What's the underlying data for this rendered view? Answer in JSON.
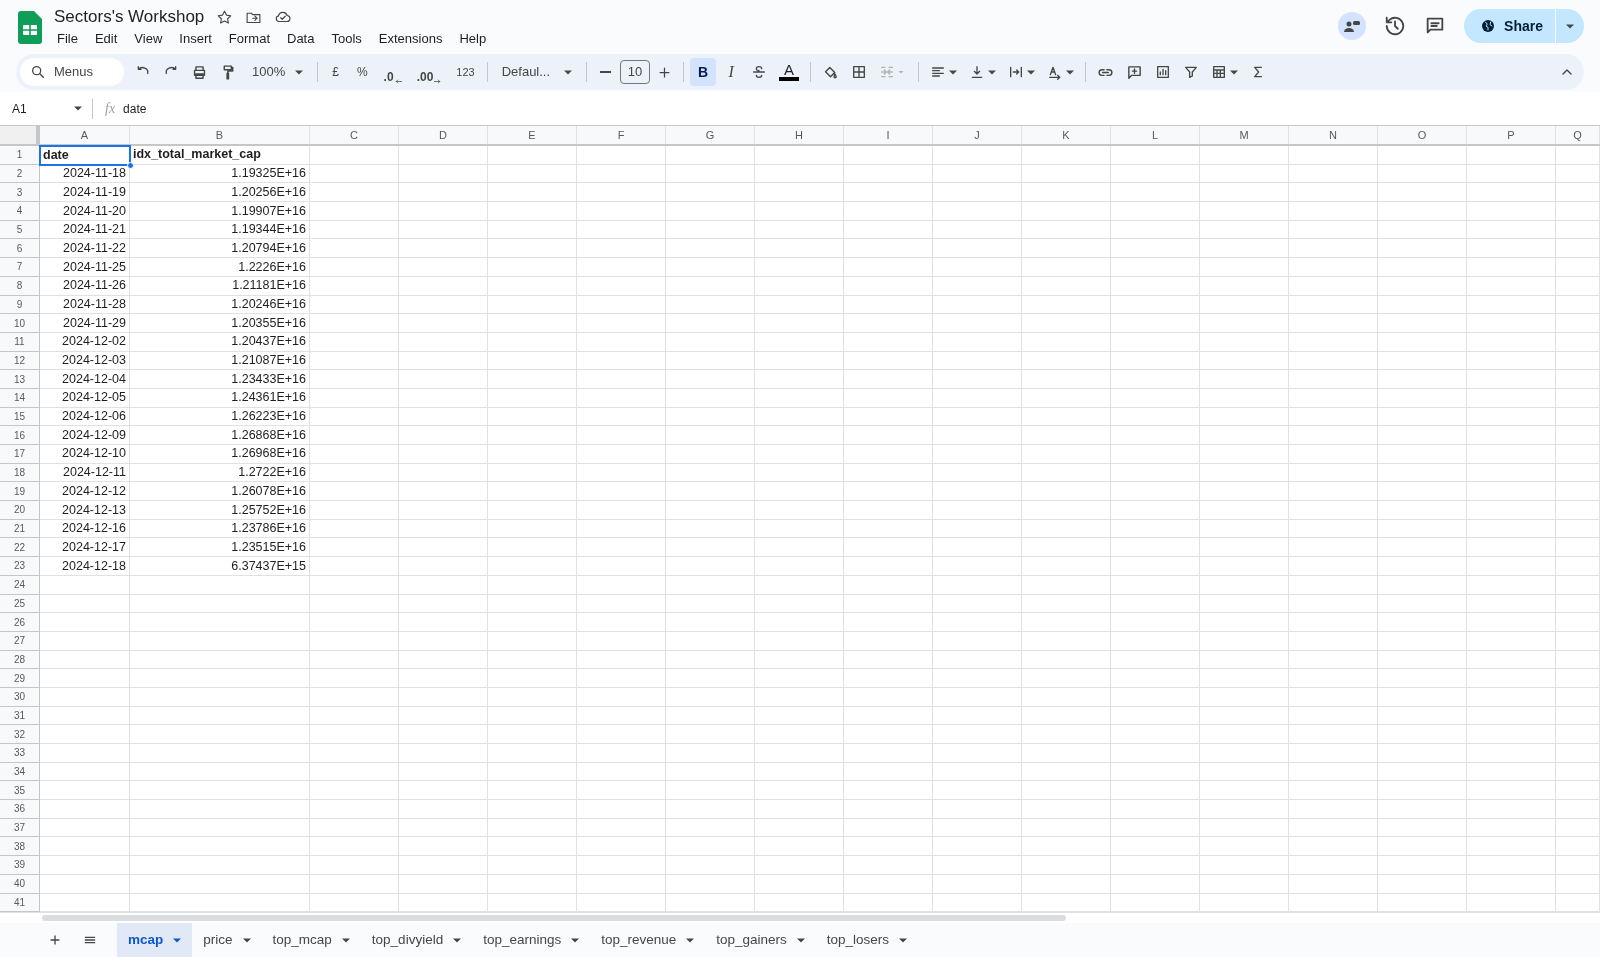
{
  "document": {
    "title": "Sectors's Workshop"
  },
  "menu": [
    "File",
    "Edit",
    "View",
    "Insert",
    "Format",
    "Data",
    "Tools",
    "Extensions",
    "Help"
  ],
  "share": {
    "label": "Share"
  },
  "toolbar": {
    "search_label": "Menus",
    "zoom": "100%",
    "currency": "£",
    "percent": "%",
    "decrease_decimals": ".0",
    "increase_decimals": ".00",
    "number_format": "123",
    "font": "Defaul...",
    "font_size": "10",
    "bold": {
      "label": "B",
      "selected": true
    },
    "italic": {
      "label": "I",
      "selected": false
    },
    "text_color": {
      "label": "A",
      "color": "#000000"
    }
  },
  "formula_bar": {
    "cell_ref": "A1",
    "fx": "fx",
    "value": "date"
  },
  "columns": [
    "A",
    "B",
    "C",
    "D",
    "E",
    "F",
    "G",
    "H",
    "I",
    "J",
    "K",
    "L",
    "M",
    "N",
    "O",
    "P",
    "Q"
  ],
  "row_numbers": [
    "1",
    "2",
    "3",
    "4",
    "5",
    "6",
    "7",
    "8",
    "9",
    "10",
    "11",
    "12",
    "13",
    "14",
    "15",
    "16",
    "17",
    "18",
    "19",
    "20",
    "21",
    "22",
    "23",
    "24",
    "25",
    "26",
    "27",
    "28",
    "29",
    "30",
    "31",
    "32",
    "33",
    "34",
    "35",
    "36",
    "37",
    "38",
    "39",
    "40",
    "41"
  ],
  "rows": [
    {
      "kind": "header",
      "cells": [
        {
          "value": "date",
          "selected": true
        },
        {
          "value": "idx_total_market_cap",
          "selected": false
        }
      ]
    },
    {
      "kind": "data",
      "cells": [
        {
          "value": "2024-11-18",
          "selected": false
        },
        {
          "value": "1.19325E+16",
          "selected": false
        }
      ]
    },
    {
      "kind": "data",
      "cells": [
        {
          "value": "2024-11-19",
          "selected": false
        },
        {
          "value": "1.20256E+16",
          "selected": false
        }
      ]
    },
    {
      "kind": "data",
      "cells": [
        {
          "value": "2024-11-20",
          "selected": false
        },
        {
          "value": "1.19907E+16",
          "selected": false
        }
      ]
    },
    {
      "kind": "data",
      "cells": [
        {
          "value": "2024-11-21",
          "selected": false
        },
        {
          "value": "1.19344E+16",
          "selected": false
        }
      ]
    },
    {
      "kind": "data",
      "cells": [
        {
          "value": "2024-11-22",
          "selected": false
        },
        {
          "value": "1.20794E+16",
          "selected": false
        }
      ]
    },
    {
      "kind": "data",
      "cells": [
        {
          "value": "2024-11-25",
          "selected": false
        },
        {
          "value": "1.2226E+16",
          "selected": false
        }
      ]
    },
    {
      "kind": "data",
      "cells": [
        {
          "value": "2024-11-26",
          "selected": false
        },
        {
          "value": "1.21181E+16",
          "selected": false
        }
      ]
    },
    {
      "kind": "data",
      "cells": [
        {
          "value": "2024-11-28",
          "selected": false
        },
        {
          "value": "1.20246E+16",
          "selected": false
        }
      ]
    },
    {
      "kind": "data",
      "cells": [
        {
          "value": "2024-11-29",
          "selected": false
        },
        {
          "value": "1.20355E+16",
          "selected": false
        }
      ]
    },
    {
      "kind": "data",
      "cells": [
        {
          "value": "2024-12-02",
          "selected": false
        },
        {
          "value": "1.20437E+16",
          "selected": false
        }
      ]
    },
    {
      "kind": "data",
      "cells": [
        {
          "value": "2024-12-03",
          "selected": false
        },
        {
          "value": "1.21087E+16",
          "selected": false
        }
      ]
    },
    {
      "kind": "data",
      "cells": [
        {
          "value": "2024-12-04",
          "selected": false
        },
        {
          "value": "1.23433E+16",
          "selected": false
        }
      ]
    },
    {
      "kind": "data",
      "cells": [
        {
          "value": "2024-12-05",
          "selected": false
        },
        {
          "value": "1.24361E+16",
          "selected": false
        }
      ]
    },
    {
      "kind": "data",
      "cells": [
        {
          "value": "2024-12-06",
          "selected": false
        },
        {
          "value": "1.26223E+16",
          "selected": false
        }
      ]
    },
    {
      "kind": "data",
      "cells": [
        {
          "value": "2024-12-09",
          "selected": false
        },
        {
          "value": "1.26868E+16",
          "selected": false
        }
      ]
    },
    {
      "kind": "data",
      "cells": [
        {
          "value": "2024-12-10",
          "selected": false
        },
        {
          "value": "1.26968E+16",
          "selected": false
        }
      ]
    },
    {
      "kind": "data",
      "cells": [
        {
          "value": "2024-12-11",
          "selected": false
        },
        {
          "value": "1.2722E+16",
          "selected": false
        }
      ]
    },
    {
      "kind": "data",
      "cells": [
        {
          "value": "2024-12-12",
          "selected": false
        },
        {
          "value": "1.26078E+16",
          "selected": false
        }
      ]
    },
    {
      "kind": "data",
      "cells": [
        {
          "value": "2024-12-13",
          "selected": false
        },
        {
          "value": "1.25752E+16",
          "selected": false
        }
      ]
    },
    {
      "kind": "data",
      "cells": [
        {
          "value": "2024-12-16",
          "selected": false
        },
        {
          "value": "1.23786E+16",
          "selected": false
        }
      ]
    },
    {
      "kind": "data",
      "cells": [
        {
          "value": "2024-12-17",
          "selected": false
        },
        {
          "value": "1.23515E+16",
          "selected": false
        }
      ]
    },
    {
      "kind": "data",
      "cells": [
        {
          "value": "2024-12-18",
          "selected": false
        },
        {
          "value": "6.37437E+15",
          "selected": false
        }
      ]
    }
  ],
  "sheet_tabs": [
    {
      "label": "mcap",
      "selected": true
    },
    {
      "label": "price",
      "selected": false
    },
    {
      "label": "top_mcap",
      "selected": false
    },
    {
      "label": "top_divyield",
      "selected": false
    },
    {
      "label": "top_earnings",
      "selected": false
    },
    {
      "label": "top_revenue",
      "selected": false
    },
    {
      "label": "top_gainers",
      "selected": false
    },
    {
      "label": "top_losers",
      "selected": false
    }
  ]
}
